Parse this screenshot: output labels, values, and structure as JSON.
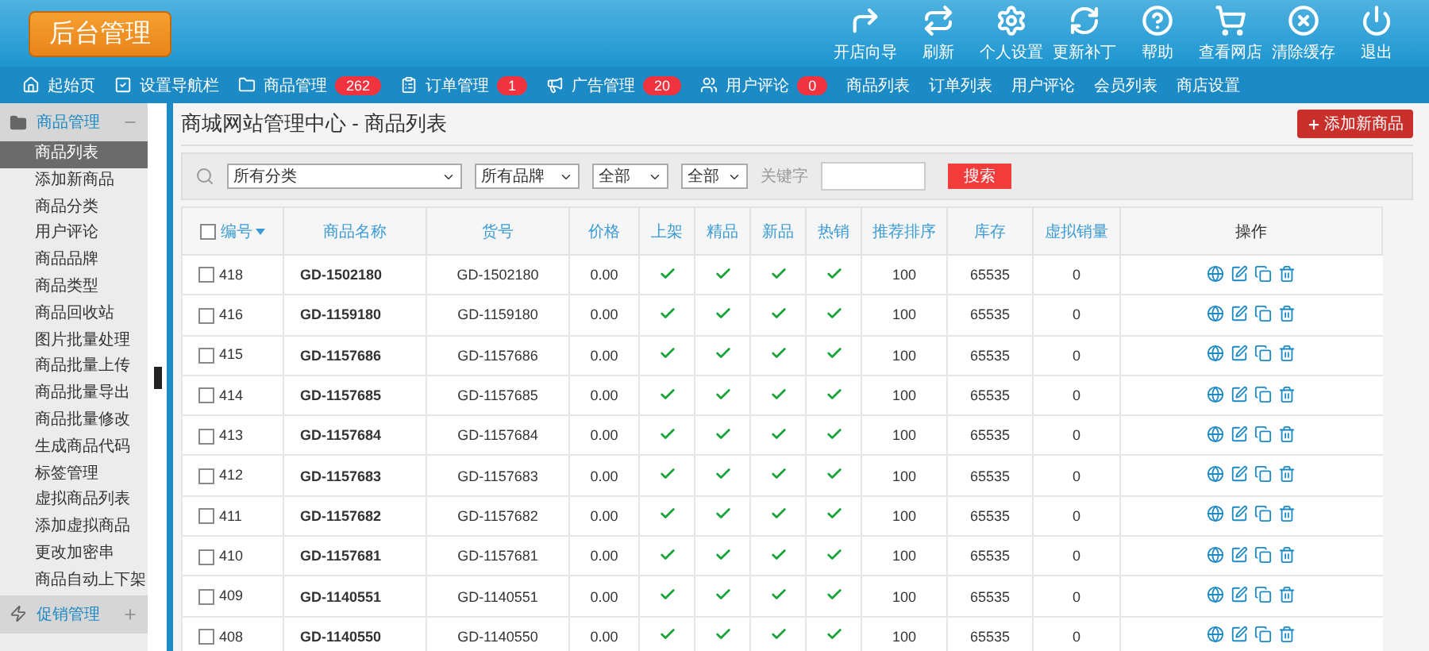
{
  "logo": "后台管理",
  "toolbar": [
    {
      "label": "开店向导"
    },
    {
      "label": "刷新"
    },
    {
      "label": "个人设置"
    },
    {
      "label": "更新补丁"
    },
    {
      "label": "帮助"
    },
    {
      "label": "查看网店"
    },
    {
      "label": "清除缓存"
    },
    {
      "label": "退出"
    }
  ],
  "nav": [
    {
      "label": "起始页"
    },
    {
      "label": "设置导航栏"
    },
    {
      "label": "商品管理",
      "badge": "262"
    },
    {
      "label": "订单管理",
      "badge": "1"
    },
    {
      "label": "广告管理",
      "badge": "20"
    },
    {
      "label": "用户评论",
      "badge": "0"
    },
    {
      "label": "商品列表"
    },
    {
      "label": "订单列表"
    },
    {
      "label": "用户评论"
    },
    {
      "label": "会员列表"
    },
    {
      "label": "商店设置"
    }
  ],
  "sidebar": {
    "groups": [
      {
        "label": "商品管理",
        "expanded": true,
        "children": [
          {
            "label": "商品列表",
            "selected": true
          },
          {
            "label": "添加新商品",
            "selected": false
          },
          {
            "label": "商品分类",
            "selected": false
          },
          {
            "label": "用户评论",
            "selected": false
          },
          {
            "label": "商品品牌",
            "selected": false
          },
          {
            "label": "商品类型",
            "selected": false
          },
          {
            "label": "商品回收站",
            "selected": false
          },
          {
            "label": "图片批量处理",
            "selected": false
          },
          {
            "label": "商品批量上传",
            "selected": false
          },
          {
            "label": "商品批量导出",
            "selected": false
          },
          {
            "label": "商品批量修改",
            "selected": false
          },
          {
            "label": "生成商品代码",
            "selected": false
          },
          {
            "label": "标签管理",
            "selected": false
          },
          {
            "label": "虚拟商品列表",
            "selected": false
          },
          {
            "label": "添加虚拟商品",
            "selected": false
          },
          {
            "label": "更改加密串",
            "selected": false
          },
          {
            "label": "商品自动上下架",
            "selected": false
          }
        ]
      },
      {
        "label": "促销管理",
        "expanded": false
      }
    ]
  },
  "page_title": "商城网站管理中心 - 商品列表",
  "add_button": "添加新商品",
  "filters": {
    "category": "所有分类",
    "brand": "所有品牌",
    "select_3": "全部",
    "select_4": "全部",
    "keyword_label": "关键字",
    "search_button": "搜索"
  },
  "table": {
    "select_all_checked": false,
    "columns": [
      "编号",
      "商品名称",
      "货号",
      "价格",
      "上架",
      "精品",
      "新品",
      "热销",
      "推荐排序",
      "库存",
      "虚拟销量",
      "操作"
    ],
    "rows": [
      {
        "id": "418",
        "name": "GD-1502180",
        "sn": "GD-1502180",
        "price": "0.00",
        "on_sale": true,
        "best": true,
        "new": true,
        "hot": true,
        "sort": "100",
        "stock": "65535",
        "virtual_sales": "0",
        "checked": false
      },
      {
        "id": "416",
        "name": "GD-1159180",
        "sn": "GD-1159180",
        "price": "0.00",
        "on_sale": true,
        "best": true,
        "new": true,
        "hot": true,
        "sort": "100",
        "stock": "65535",
        "virtual_sales": "0",
        "checked": false
      },
      {
        "id": "415",
        "name": "GD-1157686",
        "sn": "GD-1157686",
        "price": "0.00",
        "on_sale": true,
        "best": true,
        "new": true,
        "hot": true,
        "sort": "100",
        "stock": "65535",
        "virtual_sales": "0",
        "checked": false
      },
      {
        "id": "414",
        "name": "GD-1157685",
        "sn": "GD-1157685",
        "price": "0.00",
        "on_sale": true,
        "best": true,
        "new": true,
        "hot": true,
        "sort": "100",
        "stock": "65535",
        "virtual_sales": "0",
        "checked": false
      },
      {
        "id": "413",
        "name": "GD-1157684",
        "sn": "GD-1157684",
        "price": "0.00",
        "on_sale": true,
        "best": true,
        "new": true,
        "hot": true,
        "sort": "100",
        "stock": "65535",
        "virtual_sales": "0",
        "checked": false
      },
      {
        "id": "412",
        "name": "GD-1157683",
        "sn": "GD-1157683",
        "price": "0.00",
        "on_sale": true,
        "best": true,
        "new": true,
        "hot": true,
        "sort": "100",
        "stock": "65535",
        "virtual_sales": "0",
        "checked": false
      },
      {
        "id": "411",
        "name": "GD-1157682",
        "sn": "GD-1157682",
        "price": "0.00",
        "on_sale": true,
        "best": true,
        "new": true,
        "hot": true,
        "sort": "100",
        "stock": "65535",
        "virtual_sales": "0",
        "checked": false
      },
      {
        "id": "410",
        "name": "GD-1157681",
        "sn": "GD-1157681",
        "price": "0.00",
        "on_sale": true,
        "best": true,
        "new": true,
        "hot": true,
        "sort": "100",
        "stock": "65535",
        "virtual_sales": "0",
        "checked": false
      },
      {
        "id": "409",
        "name": "GD-1140551",
        "sn": "GD-1140551",
        "price": "0.00",
        "on_sale": true,
        "best": true,
        "new": true,
        "hot": true,
        "sort": "100",
        "stock": "65535",
        "virtual_sales": "0",
        "checked": false
      },
      {
        "id": "408",
        "name": "GD-1140550",
        "sn": "GD-1140550",
        "price": "0.00",
        "on_sale": true,
        "best": true,
        "new": true,
        "hot": true,
        "sort": "100",
        "stock": "65535",
        "virtual_sales": "0",
        "checked": false
      }
    ]
  }
}
